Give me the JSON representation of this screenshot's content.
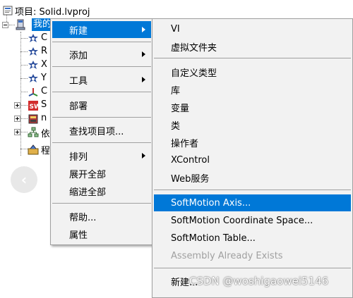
{
  "tree": {
    "project_label": "项目: Solid.lvproj",
    "selected_node_label": "我的电脑",
    "partial_rows": [
      {
        "text": "C"
      },
      {
        "text": "R"
      },
      {
        "text": "X"
      },
      {
        "text": "Y"
      },
      {
        "text": "C"
      },
      {
        "text": "S"
      },
      {
        "text": "n"
      },
      {
        "text": "依"
      },
      {
        "text": "程"
      }
    ]
  },
  "back_button": {
    "glyph": "‹"
  },
  "context_menu": {
    "items": [
      {
        "label": "新建",
        "has_submenu": true,
        "highlighted": true
      },
      {
        "label": "添加",
        "has_submenu": true
      },
      {
        "label": "工具",
        "has_submenu": true
      },
      {
        "label": "部署"
      },
      {
        "label": "查找项目项..."
      },
      {
        "label": "排列",
        "has_submenu": true
      },
      {
        "label": "展开全部"
      },
      {
        "label": "缩进全部"
      },
      {
        "label": "帮助..."
      },
      {
        "label": "属性"
      }
    ]
  },
  "submenu": {
    "items": [
      {
        "label": "VI"
      },
      {
        "label": "虚拟文件夹"
      },
      {
        "label": "自定义类型"
      },
      {
        "label": "库"
      },
      {
        "label": "变量"
      },
      {
        "label": "类"
      },
      {
        "label": "操作者"
      },
      {
        "label": "XControl"
      },
      {
        "label": "Web服务"
      },
      {
        "label": "SoftMotion Axis...",
        "highlighted": true
      },
      {
        "label": "SoftMotion Coordinate Space..."
      },
      {
        "label": "SoftMotion Table..."
      },
      {
        "label": "Assembly Already Exists",
        "disabled": true
      },
      {
        "label": "新建..."
      }
    ]
  },
  "watermark": "CSDN @woshigaowei5146",
  "colors": {
    "highlight": "#0078d7",
    "menu_bg": "#f2f2f2",
    "disabled_text": "#a0a0a0"
  }
}
